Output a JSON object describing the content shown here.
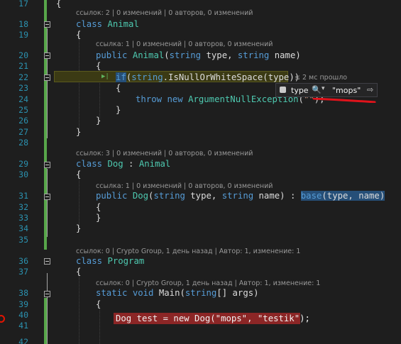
{
  "lines": [
    {
      "n": "17"
    },
    {
      "n": "18"
    },
    {
      "n": "19"
    },
    {
      "n": "20"
    },
    {
      "n": "21"
    },
    {
      "n": "22"
    },
    {
      "n": "23"
    },
    {
      "n": "24"
    },
    {
      "n": "25"
    },
    {
      "n": "26"
    },
    {
      "n": "27"
    },
    {
      "n": "28"
    },
    {
      "n": "29"
    },
    {
      "n": "30"
    },
    {
      "n": "31"
    },
    {
      "n": "32"
    },
    {
      "n": "33"
    },
    {
      "n": "34"
    },
    {
      "n": "35"
    },
    {
      "n": "36"
    },
    {
      "n": "37"
    },
    {
      "n": "38"
    },
    {
      "n": "39"
    },
    {
      "n": "40"
    },
    {
      "n": "41"
    },
    {
      "n": "42"
    }
  ],
  "lens": {
    "animal_class": "ссылок: 2 | 0 изменений | 0 авторов, 0 изменений",
    "animal_ctor": "ссылка: 1 | 0 изменений | 0 авторов, 0 изменений",
    "dog_class": "ссылок: 3 | 0 изменений | 0 авторов, 0 изменений",
    "dog_ctor": "ссылка: 1 | 0 изменений | 0 авторов, 0 изменений",
    "program_class": "ссылок: 0 | Crypto Group, 1 день назад | Автор: 1, изменение: 1",
    "main_method": "ссылок: 0 | Crypto Group, 1 день назад | Автор: 1, изменение: 1"
  },
  "code": {
    "l17": "{",
    "l18_kw": "class",
    "l18_ty": "Animal",
    "l19": "{",
    "l20_kw1": "public",
    "l20_ty": "Animal",
    "l20_p1": "(",
    "l20_kw2": "string",
    "l20_p2": " type, ",
    "l20_kw3": "string",
    "l20_p3": " name)",
    "l21": "{",
    "l22_kw": "if",
    "l22_p1": "(",
    "l22_kw2": "string",
    "l22_p2": ".IsNullOrWhiteSpace(type))",
    "l23": "{",
    "l24_kw1": "throw",
    "l24_kw2": "new",
    "l24_ty": "ArgumentNullException",
    "l24_p1": "(",
    "l24_st": "\"\"",
    "l24_p2": ");",
    "l25": "}",
    "l26": "}",
    "l27": "}",
    "l29_kw": "class",
    "l29_ty": "Dog",
    "l29_p": " : ",
    "l29_ty2": "Animal",
    "l30": "{",
    "l31_kw1": "public",
    "l31_ty": "Dog",
    "l31_p1": "(",
    "l31_kw2": "string",
    "l31_p2": " type, ",
    "l31_kw3": "string",
    "l31_p3": " name) : ",
    "l31_kw4": "base",
    "l31_p4": "(type, name)",
    "l32": "{",
    "l33": "}",
    "l34": "}",
    "l36_kw": "class",
    "l36_ty": "Program",
    "l37": "{",
    "l38_kw1": "static",
    "l38_kw2": "void",
    "l38_p": " Main(",
    "l38_kw3": "string",
    "l38_p2": "[] args)",
    "l39": "{",
    "l40": "Dog test = new Dog(\"mops\", \"testik\");"
  },
  "perf_tip": "≤ 2 мс прошло",
  "datatip": {
    "name": "type",
    "search_icon": "🔍",
    "caret": "▾",
    "value": "\"mops\"",
    "pin_icon": "⇨"
  },
  "colors": {
    "background": "#1e1e1e",
    "keyword": "#569cd6",
    "type": "#4ec9b0",
    "string": "#d69d85",
    "line_number": "#2b91af",
    "breakpoint": "#8c2626",
    "current_statement": "#3b3a14",
    "change_bar": "#57a64a"
  }
}
